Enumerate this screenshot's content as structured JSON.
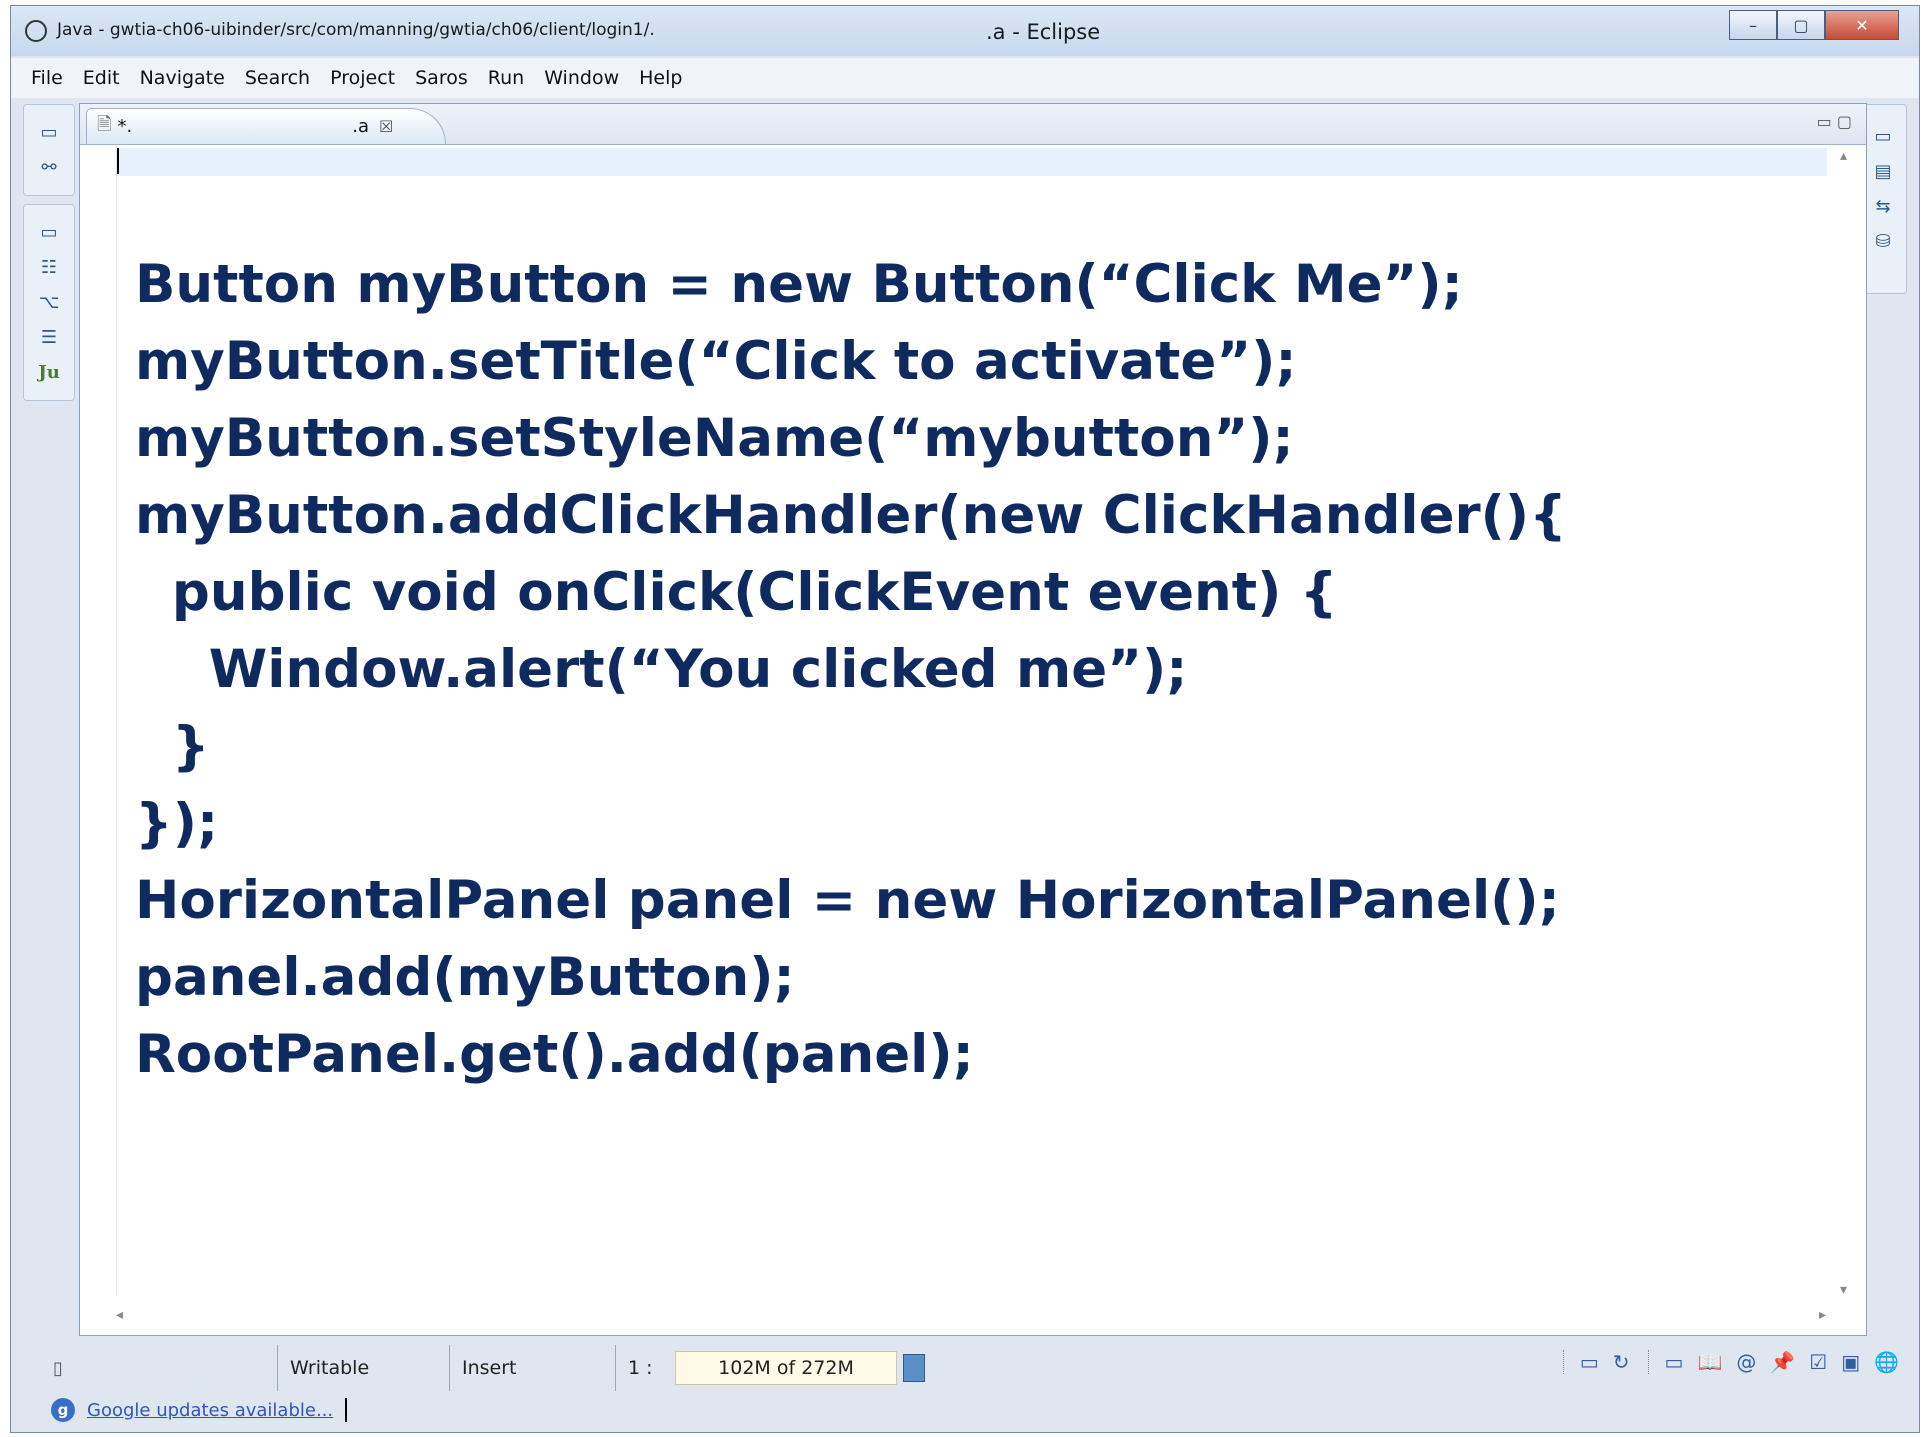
{
  "titlebar": {
    "path_text": "Java - gwtia-ch06-uibinder/src/com/manning/gwtia/ch06/client/login1/.",
    "app_text": ".a - Eclipse",
    "minimize": "–",
    "maximize": "▢",
    "close": "✕"
  },
  "menu": [
    "File",
    "Edit",
    "Navigate",
    "Search",
    "Project",
    "Saros",
    "Run",
    "Window",
    "Help"
  ],
  "editor_tab": {
    "label": "*.",
    "ext": ".a",
    "close": "☒"
  },
  "code_lines": [
    "Button myButton = new Button(“Click Me”);",
    "myButton.setTitle(“Click to activate”);",
    "myButton.setStyleName(“mybutton”);",
    "myButton.addClickHandler(new ClickHandler(){",
    "  public void onClick(ClickEvent event) {",
    "    Window.alert(“You clicked me”);",
    "  }",
    "});",
    "HorizontalPanel panel = new HorizontalPanel();",
    "panel.add(myButton);",
    "RootPanel.get().add(panel);"
  ],
  "status": {
    "writable": "Writable",
    "insert_mode": "Insert",
    "position": "1 :",
    "memory": "102M of 272M"
  },
  "updates_text": "Google updates available..."
}
